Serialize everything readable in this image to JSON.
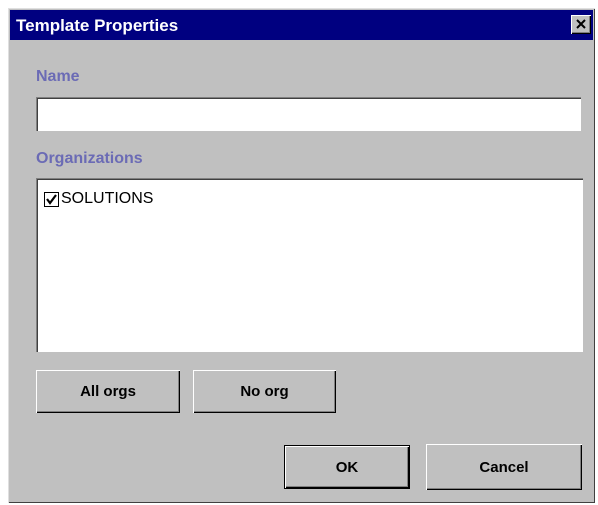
{
  "window": {
    "title": "Template Properties"
  },
  "form": {
    "name_label": "Name",
    "name_value": "",
    "organizations_label": "Organizations",
    "organizations": [
      {
        "label": "SOLUTIONS",
        "checked": true
      }
    ]
  },
  "buttons": {
    "all_orgs": "All orgs",
    "no_org": "No org",
    "ok": "OK",
    "cancel": "Cancel"
  },
  "colors": {
    "title_bar": "#000080",
    "label_text": "#6b6bb5",
    "dialog_bg": "#c0c0c0"
  },
  "icons": {
    "close": "close-icon",
    "check": "checkmark-icon"
  }
}
